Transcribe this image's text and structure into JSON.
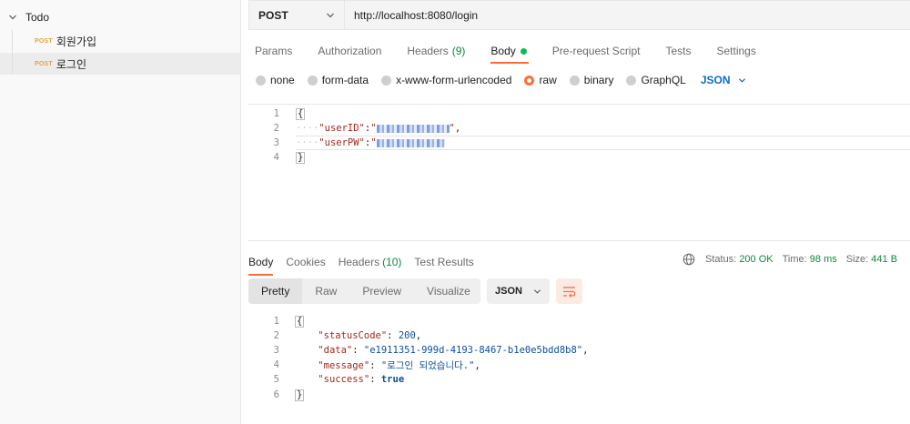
{
  "sidebar": {
    "collection": {
      "name": "Todo"
    },
    "requests": [
      {
        "method": "POST",
        "name": "회원가입"
      },
      {
        "method": "POST",
        "name": "로그인"
      }
    ]
  },
  "request": {
    "method": "POST",
    "url": "http://localhost:8080/login",
    "tabs": [
      {
        "label": "Params"
      },
      {
        "label": "Authorization"
      },
      {
        "label": "Headers",
        "count": "(9)"
      },
      {
        "label": "Body"
      },
      {
        "label": "Pre-request Script"
      },
      {
        "label": "Tests"
      },
      {
        "label": "Settings"
      }
    ],
    "body_types": [
      "none",
      "form-data",
      "x-www-form-urlencoded",
      "raw",
      "binary",
      "GraphQL"
    ],
    "body_language": "JSON",
    "body_lines": {
      "line_numbers": [
        "1",
        "2",
        "3",
        "4"
      ],
      "open": "{",
      "key1": "\"userID\"",
      "key2": "\"userPW\"",
      "close": "}"
    }
  },
  "response": {
    "tabs": [
      {
        "label": "Body"
      },
      {
        "label": "Cookies"
      },
      {
        "label": "Headers",
        "count": "(10)"
      },
      {
        "label": "Test Results"
      }
    ],
    "status_label": "Status:",
    "status_value": "200 OK",
    "time_label": "Time:",
    "time_value": "98 ms",
    "size_label": "Size:",
    "size_value": "441 B",
    "views": [
      "Pretty",
      "Raw",
      "Preview",
      "Visualize"
    ],
    "format": "JSON",
    "line_numbers": [
      "1",
      "2",
      "3",
      "4",
      "5",
      "6"
    ],
    "json": {
      "open": "{",
      "k_status": "\"statusCode\"",
      "v_status": "200",
      "k_data": "\"data\"",
      "v_data": "\"e1911351-999d-4193-8467-b1e0e5bdd8b8\"",
      "k_message": "\"message\"",
      "v_message": "\"로그인 되었습니다.\"",
      "k_success": "\"success\"",
      "v_success": "true",
      "close": "}"
    }
  },
  "colors": {
    "accent": "#ff6c37",
    "method_post": "#e8a33e",
    "success_green": "#0b8a3c",
    "link_blue": "#0b6bcb"
  }
}
